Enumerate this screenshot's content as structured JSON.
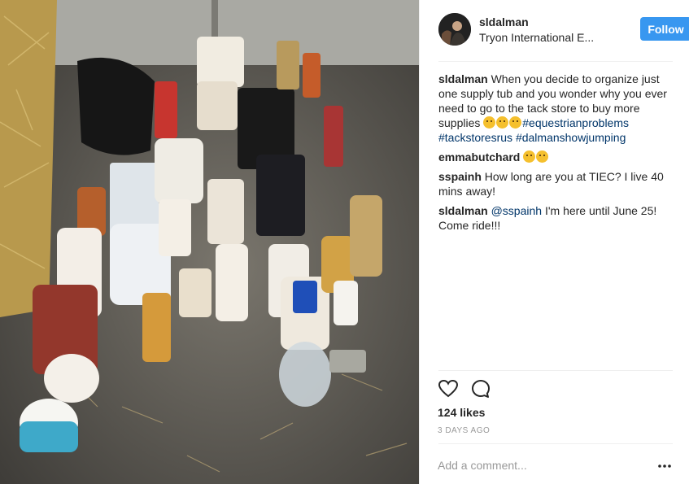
{
  "header": {
    "username": "sldalman",
    "location": "Tryon International E...",
    "follow_label": "Follow"
  },
  "caption": {
    "user": "sldalman",
    "text": "When you decide to organize just one supply tub and you wonder why you ever need to go to the tack store to buy more supplies",
    "hashtags": [
      "#equestrianproblems",
      "#tackstoresrus",
      "#dalmanshowjumping"
    ]
  },
  "comments": [
    {
      "user": "emmabutchard",
      "text": ""
    },
    {
      "user": "sspainh",
      "text": "How long are you at TIEC? I live 40 mins away!"
    },
    {
      "user": "sldalman",
      "mention": "@sspainh",
      "text": "I'm here until June 25! Come ride!!!"
    }
  ],
  "engagement": {
    "likes": "124 likes",
    "time": "3 DAYS AGO"
  },
  "composer": {
    "placeholder": "Add a comment..."
  },
  "icons": {
    "like": "heart-icon",
    "comment": "speech-bubble-icon",
    "more": "more-options-icon"
  },
  "colors": {
    "follow": "#3897f0",
    "link": "#003569",
    "muted": "#999999"
  }
}
